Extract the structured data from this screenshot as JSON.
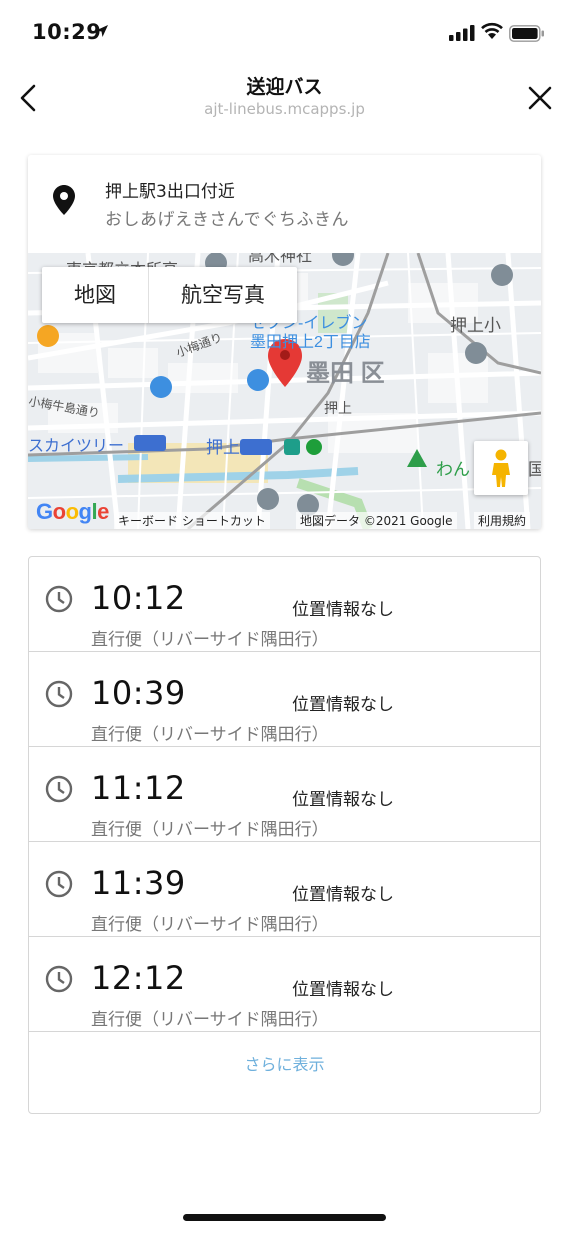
{
  "status_bar": {
    "time": "10:29"
  },
  "nav": {
    "title": "送迎バス",
    "url": "ajt-linebus.mcapps.jp"
  },
  "stop": {
    "name": "押上駅3出口付近",
    "kana": "おしあげえきさんでぐちふきん"
  },
  "map": {
    "tab_map": "地図",
    "tab_satellite": "航空写真",
    "google": "Google",
    "shortcuts": "キーボード ショートカット",
    "map_data": "地図データ ©2021 Google",
    "terms": "利用規約",
    "labels": {
      "ward": "墨田 区",
      "seven": "セブン-イレブン",
      "seven2": "墨田押上2丁目店",
      "oshiage": "押上",
      "oshiage_station": "押上",
      "oshiage_sho": "押上小",
      "skytree": "スカイツリー",
      "komeume": "小梅通り",
      "komeushi": "小梅牛島通り",
      "wan": "わん",
      "koku": "国",
      "takagi": "高木神社",
      "dormitory": "東京都立本所高"
    },
    "colors": {
      "pin": "#e53935",
      "water": "#9fd2e8",
      "park": "#b7dfb0",
      "road": "#ffffff",
      "rail": "#9e9e9e"
    }
  },
  "schedule": [
    {
      "time": "10:12",
      "location": "位置情報なし",
      "route": "直行便（リバーサイド隅田行）"
    },
    {
      "time": "10:39",
      "location": "位置情報なし",
      "route": "直行便（リバーサイド隅田行）"
    },
    {
      "time": "11:12",
      "location": "位置情報なし",
      "route": "直行便（リバーサイド隅田行）"
    },
    {
      "time": "11:39",
      "location": "位置情報なし",
      "route": "直行便（リバーサイド隅田行）"
    },
    {
      "time": "12:12",
      "location": "位置情報なし",
      "route": "直行便（リバーサイド隅田行）"
    }
  ],
  "more_label": "さらに表示"
}
